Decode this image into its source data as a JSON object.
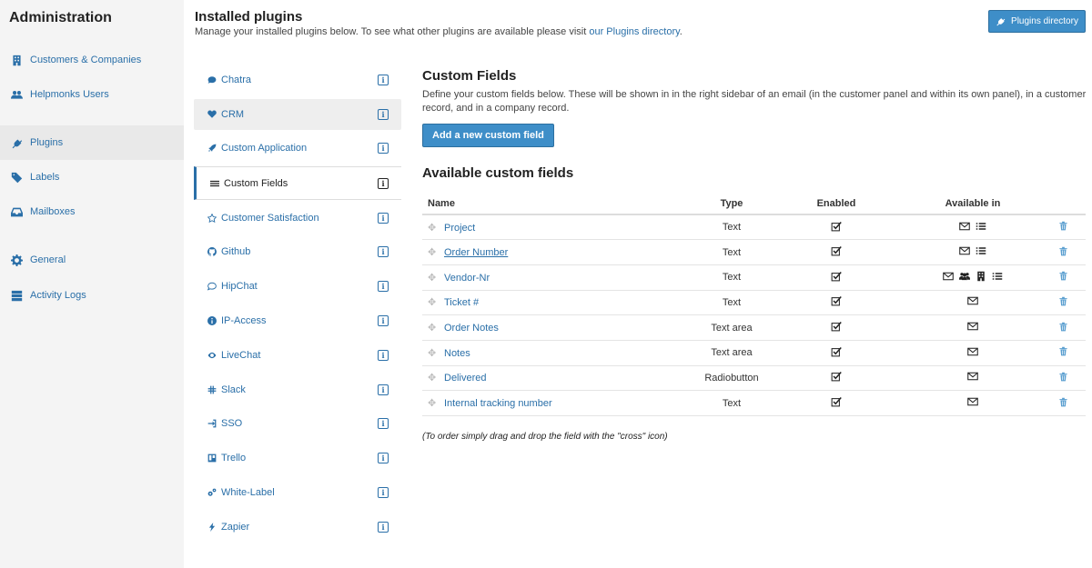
{
  "sidebar": {
    "title": "Administration",
    "items": [
      {
        "label": "Customers & Companies",
        "icon": "building-icon"
      },
      {
        "label": "Helpmonks Users",
        "icon": "users-icon"
      },
      {
        "label": "Plugins",
        "icon": "plug-icon"
      },
      {
        "label": "Labels",
        "icon": "tags-icon"
      },
      {
        "label": "Mailboxes",
        "icon": "inbox-icon"
      },
      {
        "label": "General",
        "icon": "gear-icon"
      },
      {
        "label": "Activity Logs",
        "icon": "server-icon"
      }
    ]
  },
  "header": {
    "title": "Installed plugins",
    "subtitle": "Manage your installed plugins below. To see what other plugins are available please visit ",
    "subtitle_link": "our Plugins directory",
    "subtitle_end": ".",
    "directory_button": "Plugins directory"
  },
  "plugins": [
    {
      "label": "Chatra"
    },
    {
      "label": "CRM"
    },
    {
      "label": "Custom Application"
    },
    {
      "label": "Custom Fields"
    },
    {
      "label": "Customer Satisfaction"
    },
    {
      "label": "Github"
    },
    {
      "label": "HipChat"
    },
    {
      "label": "IP-Access"
    },
    {
      "label": "LiveChat"
    },
    {
      "label": "Slack"
    },
    {
      "label": "SSO"
    },
    {
      "label": "Trello"
    },
    {
      "label": "White-Label"
    },
    {
      "label": "Zapier"
    }
  ],
  "custom_fields": {
    "title": "Custom Fields",
    "description": "Define your custom fields below. These will be shown in in the right sidebar of an email (in the customer panel and within its own panel), in a customer record, and in a company record.",
    "add_button": "Add a new custom field",
    "available_title": "Available custom fields",
    "columns": {
      "name": "Name",
      "type": "Type",
      "enabled": "Enabled",
      "available": "Available in"
    },
    "rows": [
      {
        "name": "Project",
        "type": "Text"
      },
      {
        "name": "Order Number",
        "type": "Text"
      },
      {
        "name": "Vendor-Nr",
        "type": "Text"
      },
      {
        "name": "Ticket #",
        "type": "Text"
      },
      {
        "name": "Order Notes",
        "type": "Text area"
      },
      {
        "name": "Notes",
        "type": "Text area"
      },
      {
        "name": "Delivered",
        "type": "Radiobutton"
      },
      {
        "name": "Internal tracking number",
        "type": "Text"
      }
    ],
    "footnote": "(To order simply drag and drop the field with the \"cross\" icon)"
  }
}
